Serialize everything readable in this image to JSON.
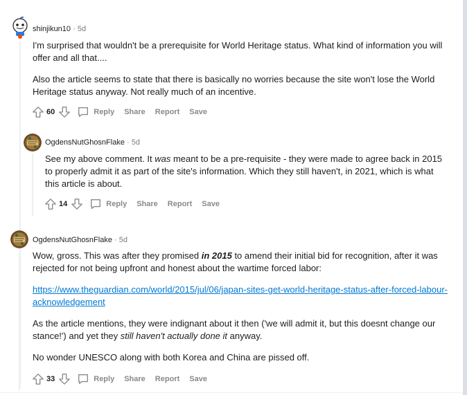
{
  "comments": [
    {
      "author": "shinjikun10",
      "separator": "·",
      "age": "5d",
      "paragraphs": [
        "I'm surprised that wouldn't be a prerequisite for World Heritage status. What kind of information you will offer and all that....",
        "Also the article seems to state that there is basically no worries because the site won't lose the World Heritage status anyway. Not really much of an incentive."
      ],
      "score": "60",
      "reply_label": "Reply",
      "share_label": "Share",
      "report_label": "Report",
      "save_label": "Save"
    },
    {
      "author": "OgdensNutGhosnFlake",
      "separator": "·",
      "age": "5d",
      "text_a": "See my above comment. It ",
      "text_em": "was",
      "text_b": " meant to be a pre-requisite - they were made to agree back in 2015 to properly admit it as part of the site's information. Which they still haven't, in 2021, which is what this article is about.",
      "score": "14",
      "reply_label": "Reply",
      "share_label": "Share",
      "report_label": "Report",
      "save_label": "Save"
    },
    {
      "author": "OgdensNutGhosnFlake",
      "separator": "·",
      "age": "5d",
      "p1_a": "Wow, gross. This was after they promised ",
      "p1_strong": "in 2015",
      "p1_b": " to amend their initial bid for recognition, after it was rejected for not being upfront and honest about the wartime forced labor:",
      "link": "https://www.theguardian.com/world/2015/jul/06/japan-sites-get-world-heritage-status-after-forced-labour-acknowledgement",
      "p3_a": "As the article mentions, they were indignant about it then ('we will admit it, but this doesnt change our stance!') and yet they ",
      "p3_em": "still haven't actually done it",
      "p3_b": " anyway.",
      "p4": "No wonder UNESCO along with both Korea and China are pissed off.",
      "score": "33",
      "reply_label": "Reply",
      "share_label": "Share",
      "report_label": "Report",
      "save_label": "Save"
    }
  ],
  "colors": {
    "meta_gray": "#7c7c7c",
    "action_gray": "#878a8c",
    "link_blue": "#0079d3",
    "thread_line": "#edeff1"
  },
  "icons": [
    "snoo-avatar-icon",
    "custom-avatar-icon",
    "upvote-icon",
    "downvote-icon",
    "comment-bubble-icon"
  ]
}
